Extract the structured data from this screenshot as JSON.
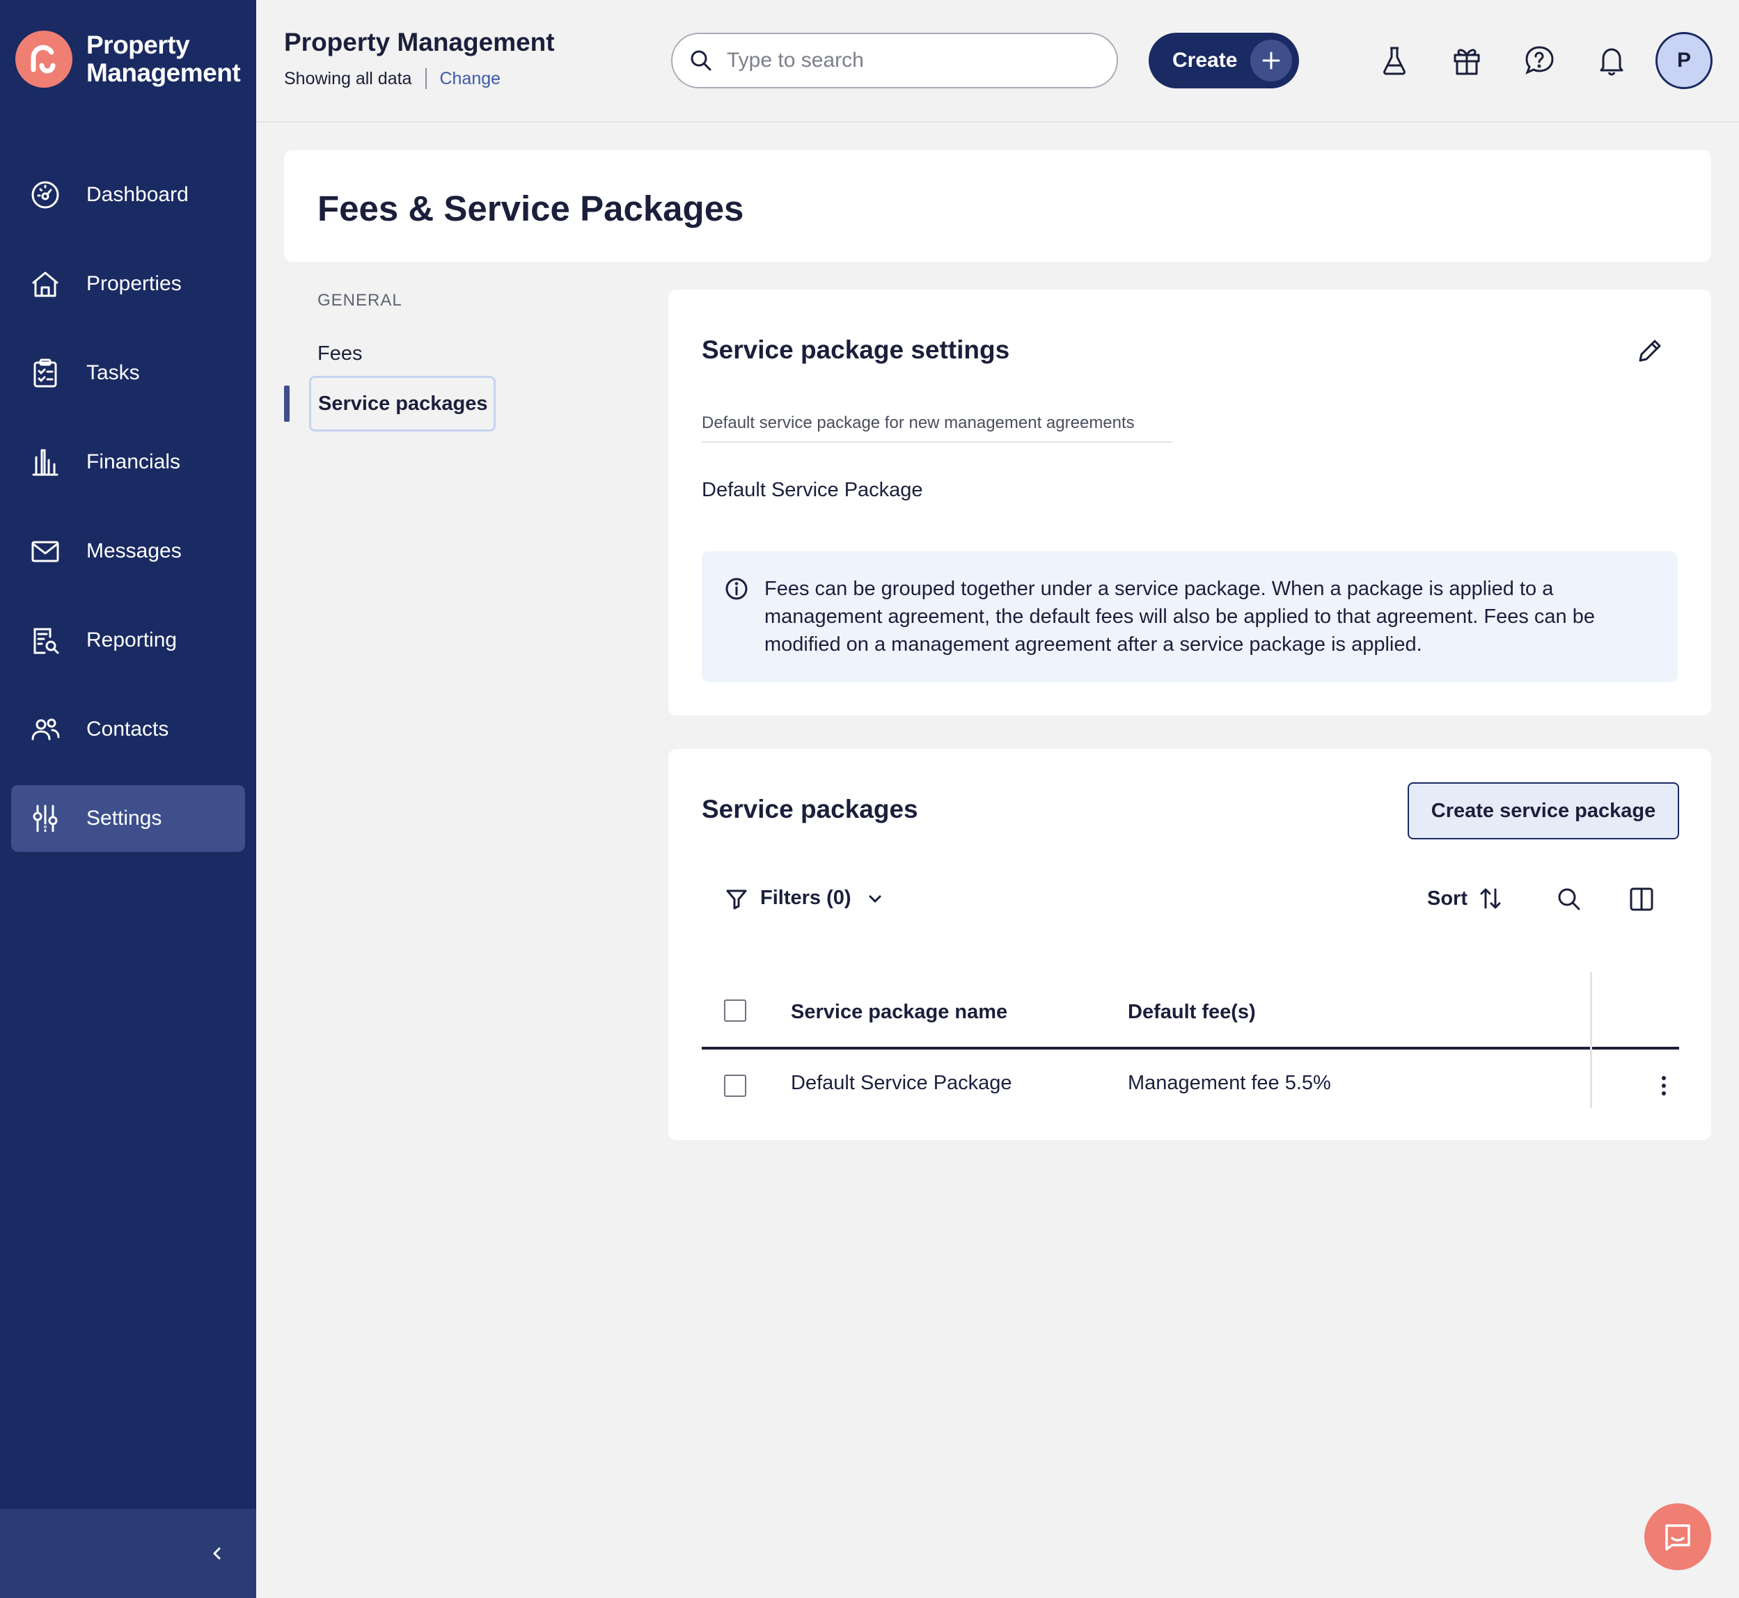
{
  "brand": {
    "line1": "Property",
    "line2": "Management"
  },
  "sidebar": {
    "items": [
      {
        "label": "Dashboard",
        "icon": "dashboard-gauge-icon"
      },
      {
        "label": "Properties",
        "icon": "house-icon"
      },
      {
        "label": "Tasks",
        "icon": "clipboard-icon"
      },
      {
        "label": "Financials",
        "icon": "bank-icon"
      },
      {
        "label": "Messages",
        "icon": "envelope-icon"
      },
      {
        "label": "Reporting",
        "icon": "report-search-icon"
      },
      {
        "label": "Contacts",
        "icon": "people-icon"
      },
      {
        "label": "Settings",
        "icon": "sliders-icon",
        "active": true
      }
    ],
    "collapse_icon": "chevron-left-icon"
  },
  "header": {
    "title": "Property Management",
    "subtitle": "Showing all data",
    "change_link": "Change",
    "search_placeholder": "Type to search",
    "create_label": "Create",
    "icons": [
      "flask-icon",
      "gift-icon",
      "help-icon",
      "bell-icon"
    ],
    "avatar_initial": "P"
  },
  "page": {
    "title": "Fees & Service Packages"
  },
  "subnav": {
    "heading": "GENERAL",
    "items": [
      {
        "label": "Fees"
      },
      {
        "label": "Service packages",
        "active": true
      }
    ]
  },
  "settings_card": {
    "title": "Service package settings",
    "field_label": "Default service package for new management agreements",
    "field_value": "Default Service Package",
    "info_text": "Fees can be grouped together under a service package. When a package is applied to a management agreement, the default fees will also be applied to that agreement. Fees can be modified on a management agreement after a service package is applied."
  },
  "packages_card": {
    "title": "Service packages",
    "create_button": "Create service package",
    "filters_label": "Filters (0)",
    "sort_label": "Sort",
    "columns": [
      "Service package name",
      "Default fee(s)"
    ],
    "rows": [
      {
        "name": "Default Service Package",
        "fees": "Management fee 5.5%"
      }
    ]
  },
  "colors": {
    "sidebar_bg": "#1a2a62",
    "sidebar_active": "#3e4f8c",
    "brand_accent": "#ef7e73",
    "link": "#3d5aa8",
    "info_bg": "#eef4fb"
  }
}
